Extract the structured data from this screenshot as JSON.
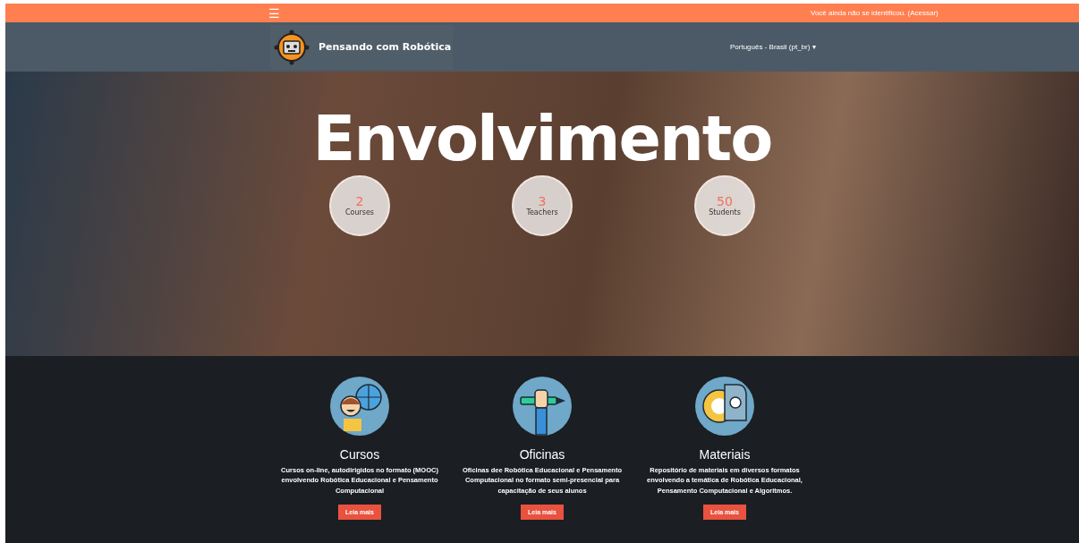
{
  "top_bar": {
    "menu_icon": "☰",
    "login_notice": "Você ainda não se identificou. (Acessar)"
  },
  "navbar": {
    "site_name": "Pensando com Robótica",
    "language": "Português - Brasil (pt_br)",
    "language_caret": "▾"
  },
  "hero": {
    "title": "Envolvimento",
    "stats": [
      {
        "value": "2",
        "label": "Courses"
      },
      {
        "value": "3",
        "label": "Teachers"
      },
      {
        "value": "50",
        "label": "Students"
      }
    ]
  },
  "features": [
    {
      "kind": "courses",
      "title": "Cursos",
      "text": "Cursos on-line, autodirigidos no formato (MOOC) envolvendo Robótica Educacional e Pensamento Computacional",
      "button": "Leia mais"
    },
    {
      "kind": "workshops",
      "title": "Oficinas",
      "text": "Oficinas dee Robótica Educacional e Pensamento Computacional no formato semi-presencial para capacitação de seus alunos",
      "button": "Leia mais"
    },
    {
      "kind": "materials",
      "title": "Materiais",
      "text": "Repositório de materiais em diversos formatos envolvendo a temática de Robótica Educacional, Pensamento Computacional e Algoritmos.",
      "button": "Leia mais"
    }
  ]
}
